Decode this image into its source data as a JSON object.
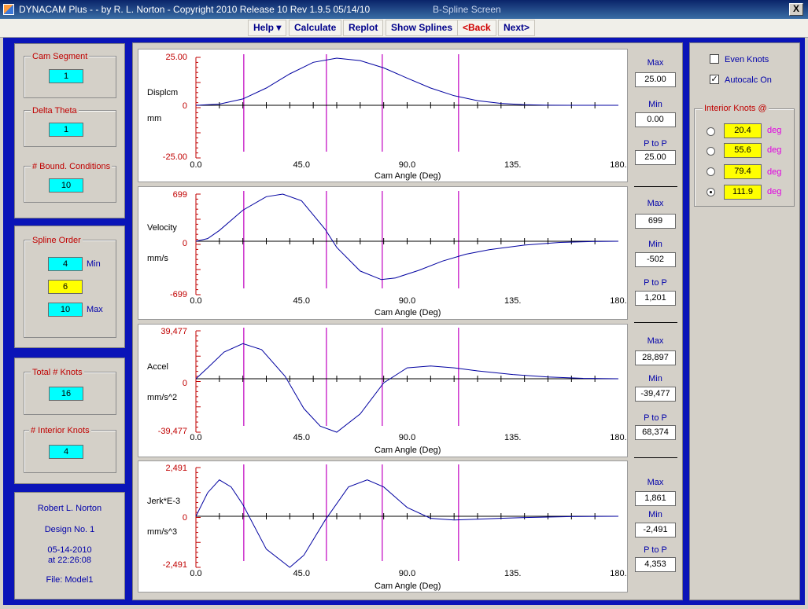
{
  "window": {
    "title": "DYNACAM Plus -  - by R. L. Norton - Copyright 2010 Release 10  Rev 1.9.5  05/14/10",
    "subtitle": "B-Spline Screen",
    "close": "X"
  },
  "menu": {
    "help": "Help  ▾",
    "calculate": "Calculate",
    "replot": "Replot",
    "show_splines": "Show Splines",
    "back": "<Back",
    "next": "Next>"
  },
  "left": {
    "cam_segment": {
      "label": "Cam Segment",
      "value": "1"
    },
    "delta_theta": {
      "label": "Delta Theta",
      "value": "1"
    },
    "bound_conditions": {
      "label": "# Bound. Conditions",
      "value": "10"
    },
    "spline_order": {
      "label": "Spline Order",
      "min": "4",
      "min_label": "Min",
      "value": "6",
      "max": "10",
      "max_label": "Max"
    },
    "total_knots": {
      "label": "Total # Knots",
      "value": "16"
    },
    "interior_knots": {
      "label": "# Interior Knots",
      "value": "4"
    },
    "info": {
      "author": "Robert L. Norton",
      "design": "Design No. 1",
      "date": "05-14-2010",
      "time": "at 22:26:08",
      "file": "File: Model1"
    }
  },
  "right": {
    "even_knots": {
      "label": "Even Knots",
      "checked": false
    },
    "autocalc": {
      "label": "Autocalc On",
      "checked": true,
      "mark": "✓"
    },
    "interior_knots_label": "Interior Knots @",
    "unit": "deg",
    "knots": [
      {
        "value": "20.4",
        "selected": false
      },
      {
        "value": "55.6",
        "selected": false
      },
      {
        "value": "79.4",
        "selected": false
      },
      {
        "value": "111.9",
        "selected": true
      }
    ]
  },
  "stats_labels": {
    "max": "Max",
    "min": "Min",
    "ptp": "P to P"
  },
  "plots": [
    {
      "label": "Displcm",
      "unit": "mm",
      "top": "25.00",
      "mid": "0",
      "bottom": "-25.00",
      "max": "25.00",
      "min": "0.00",
      "ptp": "25.00"
    },
    {
      "label": "Velocity",
      "unit": "mm/s",
      "top": "699",
      "mid": "0",
      "bottom": "-699",
      "max": "699",
      "min": "-502",
      "ptp": "1,201"
    },
    {
      "label": "Accel",
      "unit": "mm/s^2",
      "top": "39,477",
      "mid": "0",
      "bottom": "-39,477",
      "max": "28,897",
      "min": "-39,477",
      "ptp": "68,374"
    },
    {
      "label": "Jerk*E-3",
      "unit": "mm/s^3",
      "top": "2,491",
      "mid": "0",
      "bottom": "-2,491",
      "max": "1,861",
      "min": "-2,491",
      "ptp": "4,353"
    }
  ],
  "xaxis": {
    "label": "Cam Angle (Deg)",
    "ticks": [
      "0.0",
      "45.0",
      "90.0",
      "135.",
      "180."
    ]
  },
  "chart_data": [
    {
      "type": "line",
      "title": "",
      "ylabel": "Displcm mm",
      "xlabel": "Cam Angle (Deg)",
      "xlim": [
        0,
        180
      ],
      "ylim": [
        -25,
        25
      ],
      "knot_lines": [
        20.4,
        55.6,
        79.4,
        111.9
      ],
      "x": [
        0,
        10,
        20,
        30,
        40,
        50,
        60,
        70,
        80,
        90,
        100,
        110,
        120,
        130,
        140,
        150,
        160,
        170,
        180
      ],
      "y": [
        0,
        0.6,
        3.3,
        9.0,
        16.4,
        22.4,
        24.6,
        23.3,
        19.5,
        14.2,
        9.0,
        5.0,
        2.4,
        1.0,
        0.3,
        0.05,
        0,
        0,
        0
      ]
    },
    {
      "type": "line",
      "title": "",
      "ylabel": "Velocity mm/s",
      "xlabel": "Cam Angle (Deg)",
      "xlim": [
        0,
        180
      ],
      "ylim": [
        -699,
        699
      ],
      "knot_lines": [
        20.4,
        55.6,
        79.4,
        111.9
      ],
      "x": [
        0,
        5,
        10,
        20,
        30,
        37,
        45,
        55,
        60,
        70,
        79,
        85,
        95,
        105,
        115,
        125,
        140,
        155,
        170,
        180
      ],
      "y": [
        0,
        40,
        160,
        460,
        660,
        699,
        600,
        180,
        -80,
        -390,
        -502,
        -480,
        -380,
        -260,
        -170,
        -110,
        -50,
        -15,
        -3,
        0
      ]
    },
    {
      "type": "line",
      "title": "",
      "ylabel": "Accel mm/s^2",
      "xlabel": "Cam Angle (Deg)",
      "xlim": [
        0,
        180
      ],
      "ylim": [
        -39477,
        39477
      ],
      "knot_lines": [
        20.4,
        55.6,
        79.4,
        111.9
      ],
      "x": [
        0,
        5,
        12,
        20,
        28,
        38,
        46,
        53,
        60,
        70,
        80,
        90,
        100,
        110,
        120,
        135,
        150,
        165,
        180
      ],
      "y": [
        0,
        9000,
        22000,
        28897,
        24000,
        2000,
        -22000,
        -35000,
        -39477,
        -26000,
        -3000,
        9000,
        10500,
        9000,
        6500,
        3500,
        1500,
        300,
        0
      ]
    },
    {
      "type": "line",
      "title": "",
      "ylabel": "Jerk*E-3 mm/s^3",
      "xlabel": "Cam Angle (Deg)",
      "xlim": [
        0,
        180
      ],
      "ylim": [
        -2491,
        2491
      ],
      "knot_lines": [
        20.4,
        55.6,
        79.4,
        111.9
      ],
      "x": [
        0,
        5,
        10,
        15,
        20,
        30,
        40,
        46,
        55,
        65,
        73,
        80,
        90,
        100,
        110,
        125,
        140,
        160,
        180
      ],
      "y": [
        0,
        1200,
        1861,
        1500,
        600,
        -1600,
        -2491,
        -1900,
        -200,
        1500,
        1861,
        1500,
        450,
        -100,
        -180,
        -120,
        -60,
        -15,
        0
      ]
    }
  ]
}
